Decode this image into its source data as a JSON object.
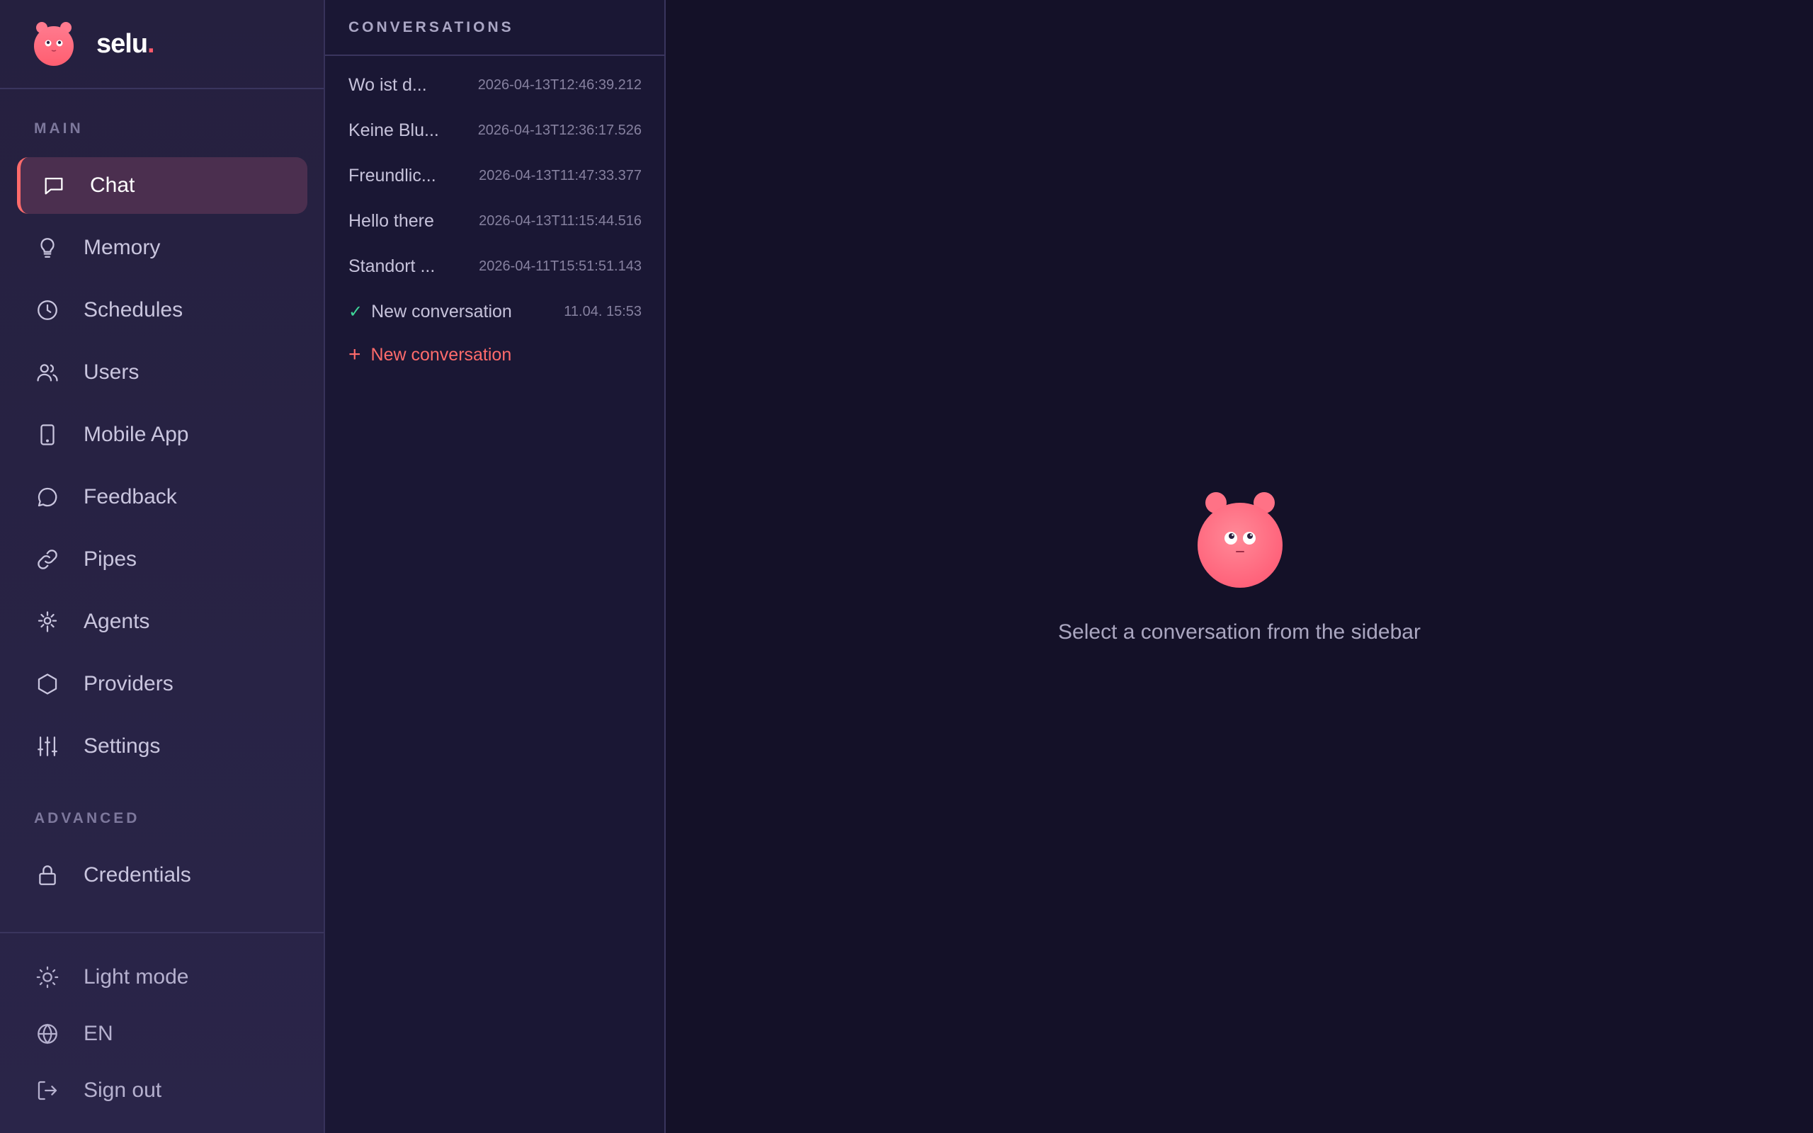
{
  "app": {
    "brand_name": "selu",
    "brand_dot": ".",
    "accent_color": "#ff6b6b"
  },
  "sidebar": {
    "main_label": "MAIN",
    "advanced_label": "ADVANCED",
    "items": [
      {
        "label": "Chat",
        "icon": "chat-icon",
        "active": true
      },
      {
        "label": "Memory",
        "icon": "lightbulb-icon"
      },
      {
        "label": "Schedules",
        "icon": "clock-icon"
      },
      {
        "label": "Users",
        "icon": "users-icon"
      },
      {
        "label": "Mobile App",
        "icon": "phone-icon"
      },
      {
        "label": "Feedback",
        "icon": "message-circle-icon"
      },
      {
        "label": "Pipes",
        "icon": "link-icon"
      },
      {
        "label": "Agents",
        "icon": "agent-icon"
      },
      {
        "label": "Providers",
        "icon": "hexagon-icon"
      },
      {
        "label": "Settings",
        "icon": "sliders-icon"
      }
    ],
    "advanced_items": [
      {
        "label": "Credentials",
        "icon": "lock-icon"
      }
    ],
    "bottom": {
      "theme_label": "Light mode",
      "language_label": "EN",
      "signout_label": "Sign out"
    }
  },
  "conversations": {
    "header": "CONVERSATIONS",
    "items": [
      {
        "title": "Wo ist d...",
        "time": "2026-04-13T12:46:39.212"
      },
      {
        "title": "Keine Blu...",
        "time": "2026-04-13T12:36:17.526"
      },
      {
        "title": "Freundlic...",
        "time": "2026-04-13T11:47:33.377"
      },
      {
        "title": "Hello there",
        "time": "2026-04-13T11:15:44.516"
      },
      {
        "title": "Standort ...",
        "time": "2026-04-11T15:51:51.143"
      },
      {
        "title": "New conversation",
        "time": "11.04. 15:53",
        "check": "✓"
      }
    ],
    "new_label": "New conversation",
    "new_plus": "+"
  },
  "main": {
    "empty_text": "Select a conversation from the sidebar"
  }
}
